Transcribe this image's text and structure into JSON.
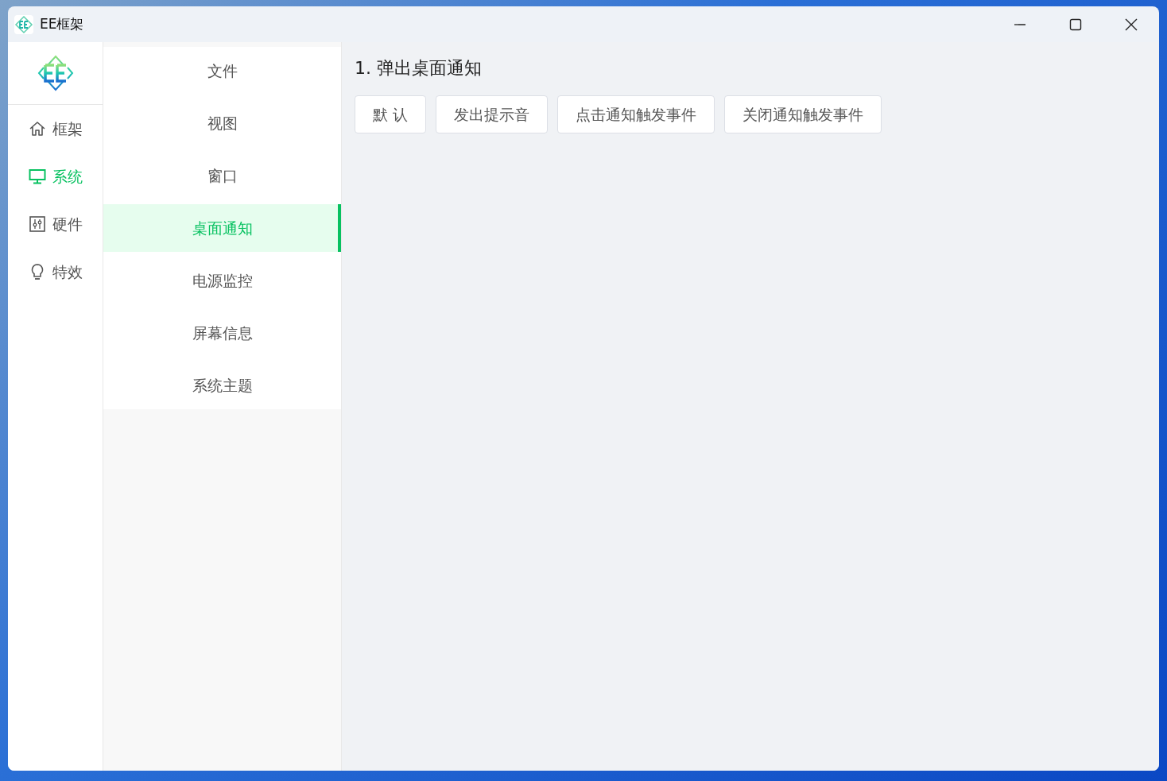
{
  "window": {
    "title": "EE框架"
  },
  "rail": {
    "items": [
      {
        "label": "框架",
        "kind": "home",
        "selected": false
      },
      {
        "label": "系统",
        "kind": "monitor",
        "selected": true
      },
      {
        "label": "硬件",
        "kind": "sliders",
        "selected": false
      },
      {
        "label": "特效",
        "kind": "bulb",
        "selected": false
      }
    ]
  },
  "submenu": {
    "items": [
      {
        "label": "文件",
        "selected": false
      },
      {
        "label": "视图",
        "selected": false
      },
      {
        "label": "窗口",
        "selected": false
      },
      {
        "label": "桌面通知",
        "selected": true
      },
      {
        "label": "电源监控",
        "selected": false
      },
      {
        "label": "屏幕信息",
        "selected": false
      },
      {
        "label": "系统主题",
        "selected": false
      }
    ]
  },
  "content": {
    "heading": "1. 弹出桌面通知",
    "buttons": [
      "默 认",
      "发出提示音",
      "点击通知触发事件",
      "关闭通知触发事件"
    ]
  }
}
